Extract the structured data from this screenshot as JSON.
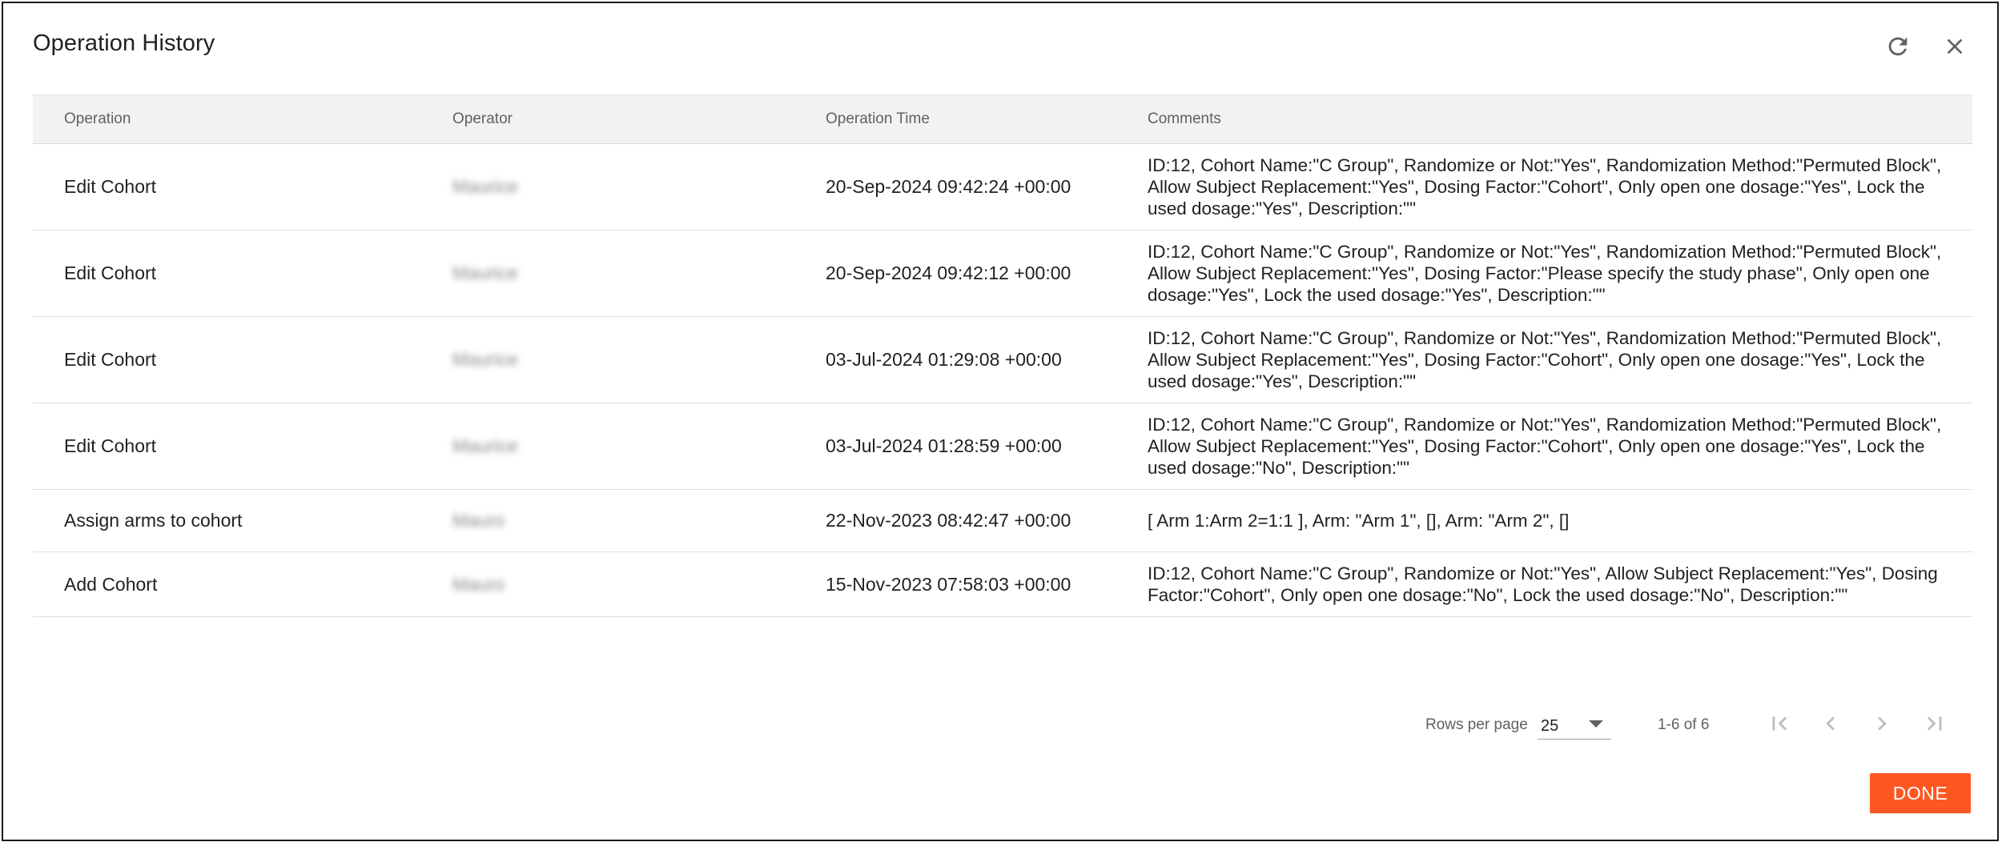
{
  "dialog": {
    "title": "Operation History"
  },
  "icons": {
    "refresh": "refresh-icon",
    "close": "close-icon",
    "first_page": "first-page-icon",
    "prev_page": "chevron-left-icon",
    "next_page": "chevron-right-icon",
    "last_page": "last-page-icon",
    "dropdown": "caret-down-icon"
  },
  "table": {
    "headers": {
      "operation": "Operation",
      "operator": "Operator",
      "time": "Operation Time",
      "comments": "Comments"
    },
    "rows": [
      {
        "operation": "Edit Cohort",
        "operator": "Maurice",
        "time": "20-Sep-2024 09:42:24 +00:00",
        "comments": "ID:12, Cohort Name:\"C Group\", Randomize or Not:\"Yes\", Randomization Method:\"Permuted Block\", Allow Subject Replacement:\"Yes\", Dosing Factor:\"Cohort\", Only open one dosage:\"Yes\", Lock the used dosage:\"Yes\", Description:\"\""
      },
      {
        "operation": "Edit Cohort",
        "operator": "Maurice",
        "time": "20-Sep-2024 09:42:12 +00:00",
        "comments": "ID:12, Cohort Name:\"C Group\", Randomize or Not:\"Yes\", Randomization Method:\"Permuted Block\", Allow Subject Replacement:\"Yes\", Dosing Factor:\"Please specify the study phase\", Only open one dosage:\"Yes\", Lock the used dosage:\"Yes\", Description:\"\""
      },
      {
        "operation": "Edit Cohort",
        "operator": "Maurice",
        "time": "03-Jul-2024 01:29:08 +00:00",
        "comments": "ID:12, Cohort Name:\"C Group\", Randomize or Not:\"Yes\", Randomization Method:\"Permuted Block\", Allow Subject Replacement:\"Yes\", Dosing Factor:\"Cohort\", Only open one dosage:\"Yes\", Lock the used dosage:\"Yes\", Description:\"\""
      },
      {
        "operation": "Edit Cohort",
        "operator": "Maurice",
        "time": "03-Jul-2024 01:28:59 +00:00",
        "comments": "ID:12, Cohort Name:\"C Group\", Randomize or Not:\"Yes\", Randomization Method:\"Permuted Block\", Allow Subject Replacement:\"Yes\", Dosing Factor:\"Cohort\", Only open one dosage:\"Yes\", Lock the used dosage:\"No\", Description:\"\""
      },
      {
        "operation": "Assign arms to cohort",
        "operator": "Mauro",
        "time": "22-Nov-2023 08:42:47 +00:00",
        "comments": "[ Arm 1:Arm 2=1:1 ], Arm: \"Arm 1\", [], Arm: \"Arm 2\", []"
      },
      {
        "operation": "Add Cohort",
        "operator": "Mauro",
        "time": "15-Nov-2023 07:58:03 +00:00",
        "comments": "ID:12, Cohort Name:\"C Group\", Randomize or Not:\"Yes\", Allow Subject Replacement:\"Yes\", Dosing Factor:\"Cohort\", Only open one dosage:\"No\", Lock the used dosage:\"No\", Description:\"\""
      }
    ]
  },
  "pagination": {
    "rows_per_page_label": "Rows per page",
    "rows_per_page_value": "25",
    "range": "1-6 of 6"
  },
  "actions": {
    "done_label": "DONE"
  },
  "colors": {
    "accent": "#ff5722",
    "header_bg": "#f2f2f2",
    "border": "#dedede"
  }
}
